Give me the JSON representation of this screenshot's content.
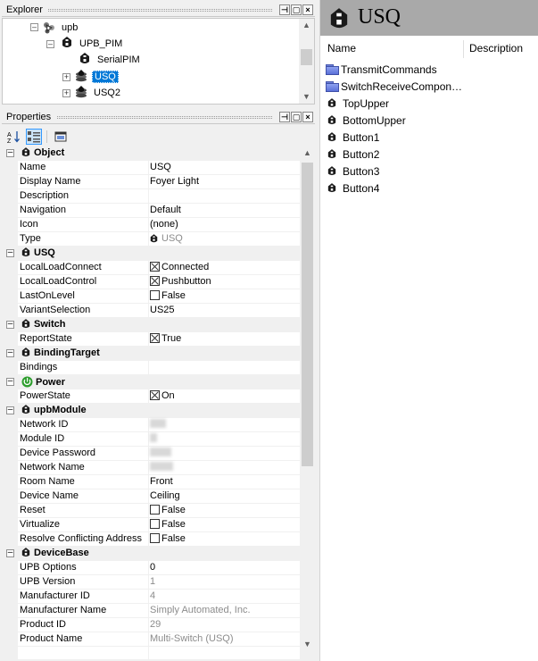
{
  "explorer": {
    "title": "Explorer",
    "tree": [
      {
        "label": "upb",
        "icon": "network-icon"
      },
      {
        "label": "UPB_PIM",
        "icon": "device-icon"
      },
      {
        "label": "SerialPIM",
        "icon": "device-icon"
      },
      {
        "label": "USQ",
        "icon": "switch-stack-icon",
        "selected": true
      },
      {
        "label": "USQ2",
        "icon": "switch-stack-icon"
      }
    ]
  },
  "properties": {
    "title": "Properties",
    "categories": {
      "object": "Object",
      "usq": "USQ",
      "switch": "Switch",
      "binding_target": "BindingTarget",
      "power": "Power",
      "upb_module": "upbModule",
      "device_base": "DeviceBase"
    },
    "rows": {
      "name": {
        "label": "Name",
        "value": "USQ"
      },
      "display_name": {
        "label": "Display Name",
        "value": "Foyer Light"
      },
      "description": {
        "label": "Description",
        "value": ""
      },
      "navigation": {
        "label": "Navigation",
        "value": "Default"
      },
      "icon": {
        "label": "Icon",
        "value": "(none)"
      },
      "type": {
        "label": "Type",
        "value": "USQ"
      },
      "local_load_connect": {
        "label": "LocalLoadConnect",
        "value": "Connected",
        "checked": true
      },
      "local_load_control": {
        "label": "LocalLoadControl",
        "value": "Pushbutton",
        "checked": true
      },
      "last_on_level": {
        "label": "LastOnLevel",
        "value": "False",
        "checked": false
      },
      "variant_selection": {
        "label": "VariantSelection",
        "value": "US25"
      },
      "report_state": {
        "label": "ReportState",
        "value": "True",
        "checked": true
      },
      "bindings": {
        "label": "Bindings",
        "value": ""
      },
      "power_state": {
        "label": "PowerState",
        "value": "On",
        "checked": true
      },
      "network_id": {
        "label": "Network ID"
      },
      "module_id": {
        "label": "Module ID"
      },
      "device_password": {
        "label": "Device Password"
      },
      "network_name": {
        "label": "Network Name"
      },
      "room_name": {
        "label": "Room Name",
        "value": "Front"
      },
      "device_name": {
        "label": "Device Name",
        "value": "Ceiling"
      },
      "reset": {
        "label": "Reset",
        "value": "False",
        "checked": false
      },
      "virtualize": {
        "label": "Virtualize",
        "value": "False",
        "checked": false
      },
      "resolve_conflicting": {
        "label": "Resolve Conflicting Address",
        "value": "False",
        "checked": false
      },
      "upb_options": {
        "label": "UPB Options",
        "value": "0"
      },
      "upb_version": {
        "label": "UPB Version",
        "value": "1"
      },
      "manufacturer_id": {
        "label": "Manufacturer ID",
        "value": "4"
      },
      "manufacturer_name": {
        "label": "Manufacturer Name",
        "value": "Simply Automated, Inc."
      },
      "product_id": {
        "label": "Product ID",
        "value": "29"
      },
      "product_name": {
        "label": "Product Name",
        "value": "Multi-Switch (USQ)"
      }
    }
  },
  "detail": {
    "title": "USQ",
    "columns": {
      "name": "Name",
      "description": "Description"
    },
    "items": [
      {
        "label": "TransmitCommands",
        "icon": "folder-icon"
      },
      {
        "label": "SwitchReceiveCompon…",
        "icon": "folder-icon"
      },
      {
        "label": "TopUpper",
        "icon": "device-icon"
      },
      {
        "label": "BottomUpper",
        "icon": "device-icon"
      },
      {
        "label": "Button1",
        "icon": "device-icon"
      },
      {
        "label": "Button2",
        "icon": "device-icon"
      },
      {
        "label": "Button3",
        "icon": "device-icon"
      },
      {
        "label": "Button4",
        "icon": "device-icon"
      }
    ]
  },
  "colors": {
    "selection": "#0078d7",
    "header_gray": "#a9a9a9",
    "power_green": "#2e9e2e"
  }
}
